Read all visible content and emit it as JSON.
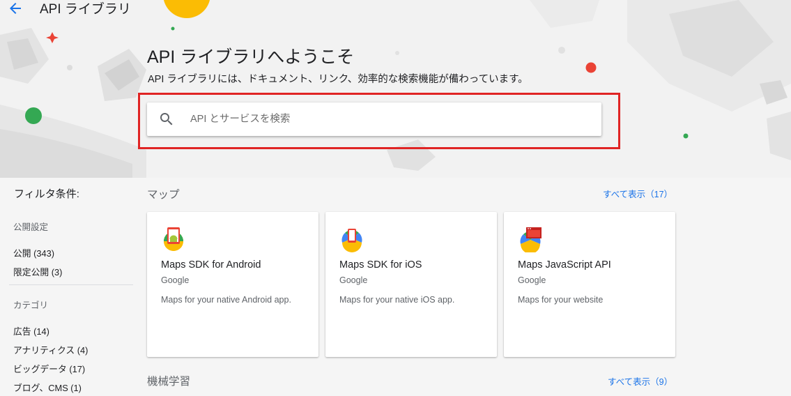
{
  "header": {
    "title": "API ライブラリ"
  },
  "hero": {
    "title": "API ライブラリへようこそ",
    "subtitle": "API ライブラリには、ドキュメント、リンク、効率的な検索機能が備わっています。"
  },
  "search": {
    "placeholder": "API とサービスを検索",
    "value": ""
  },
  "sidebar": {
    "filter_title": "フィルタ条件:",
    "visibility": {
      "label": "公開設定",
      "items": [
        {
          "label": "公開 (343)"
        },
        {
          "label": "限定公開 (3)"
        }
      ]
    },
    "category": {
      "label": "カテゴリ",
      "items": [
        {
          "label": "広告 (14)"
        },
        {
          "label": "アナリティクス (4)"
        },
        {
          "label": "ビッグデータ (17)"
        },
        {
          "label": "ブログ、CMS (1)"
        }
      ]
    }
  },
  "sections": [
    {
      "heading": "マップ",
      "see_all": "すべて表示（17）",
      "cards": [
        {
          "title": "Maps SDK for Android",
          "vendor": "Google",
          "description": "Maps for your native Android app.",
          "icon": "maps-android-icon"
        },
        {
          "title": "Maps SDK for iOS",
          "vendor": "Google",
          "description": "Maps for your native iOS app.",
          "icon": "maps-ios-icon"
        },
        {
          "title": "Maps JavaScript API",
          "vendor": "Google",
          "description": "Maps for your website",
          "icon": "maps-javascript-icon"
        }
      ]
    },
    {
      "heading": "機械学習",
      "see_all": "すべて表示（9）"
    }
  ],
  "colors": {
    "accent": "#1a73e8",
    "highlight": "#e02424",
    "text": "#202124",
    "secondary_text": "#5f6368"
  }
}
